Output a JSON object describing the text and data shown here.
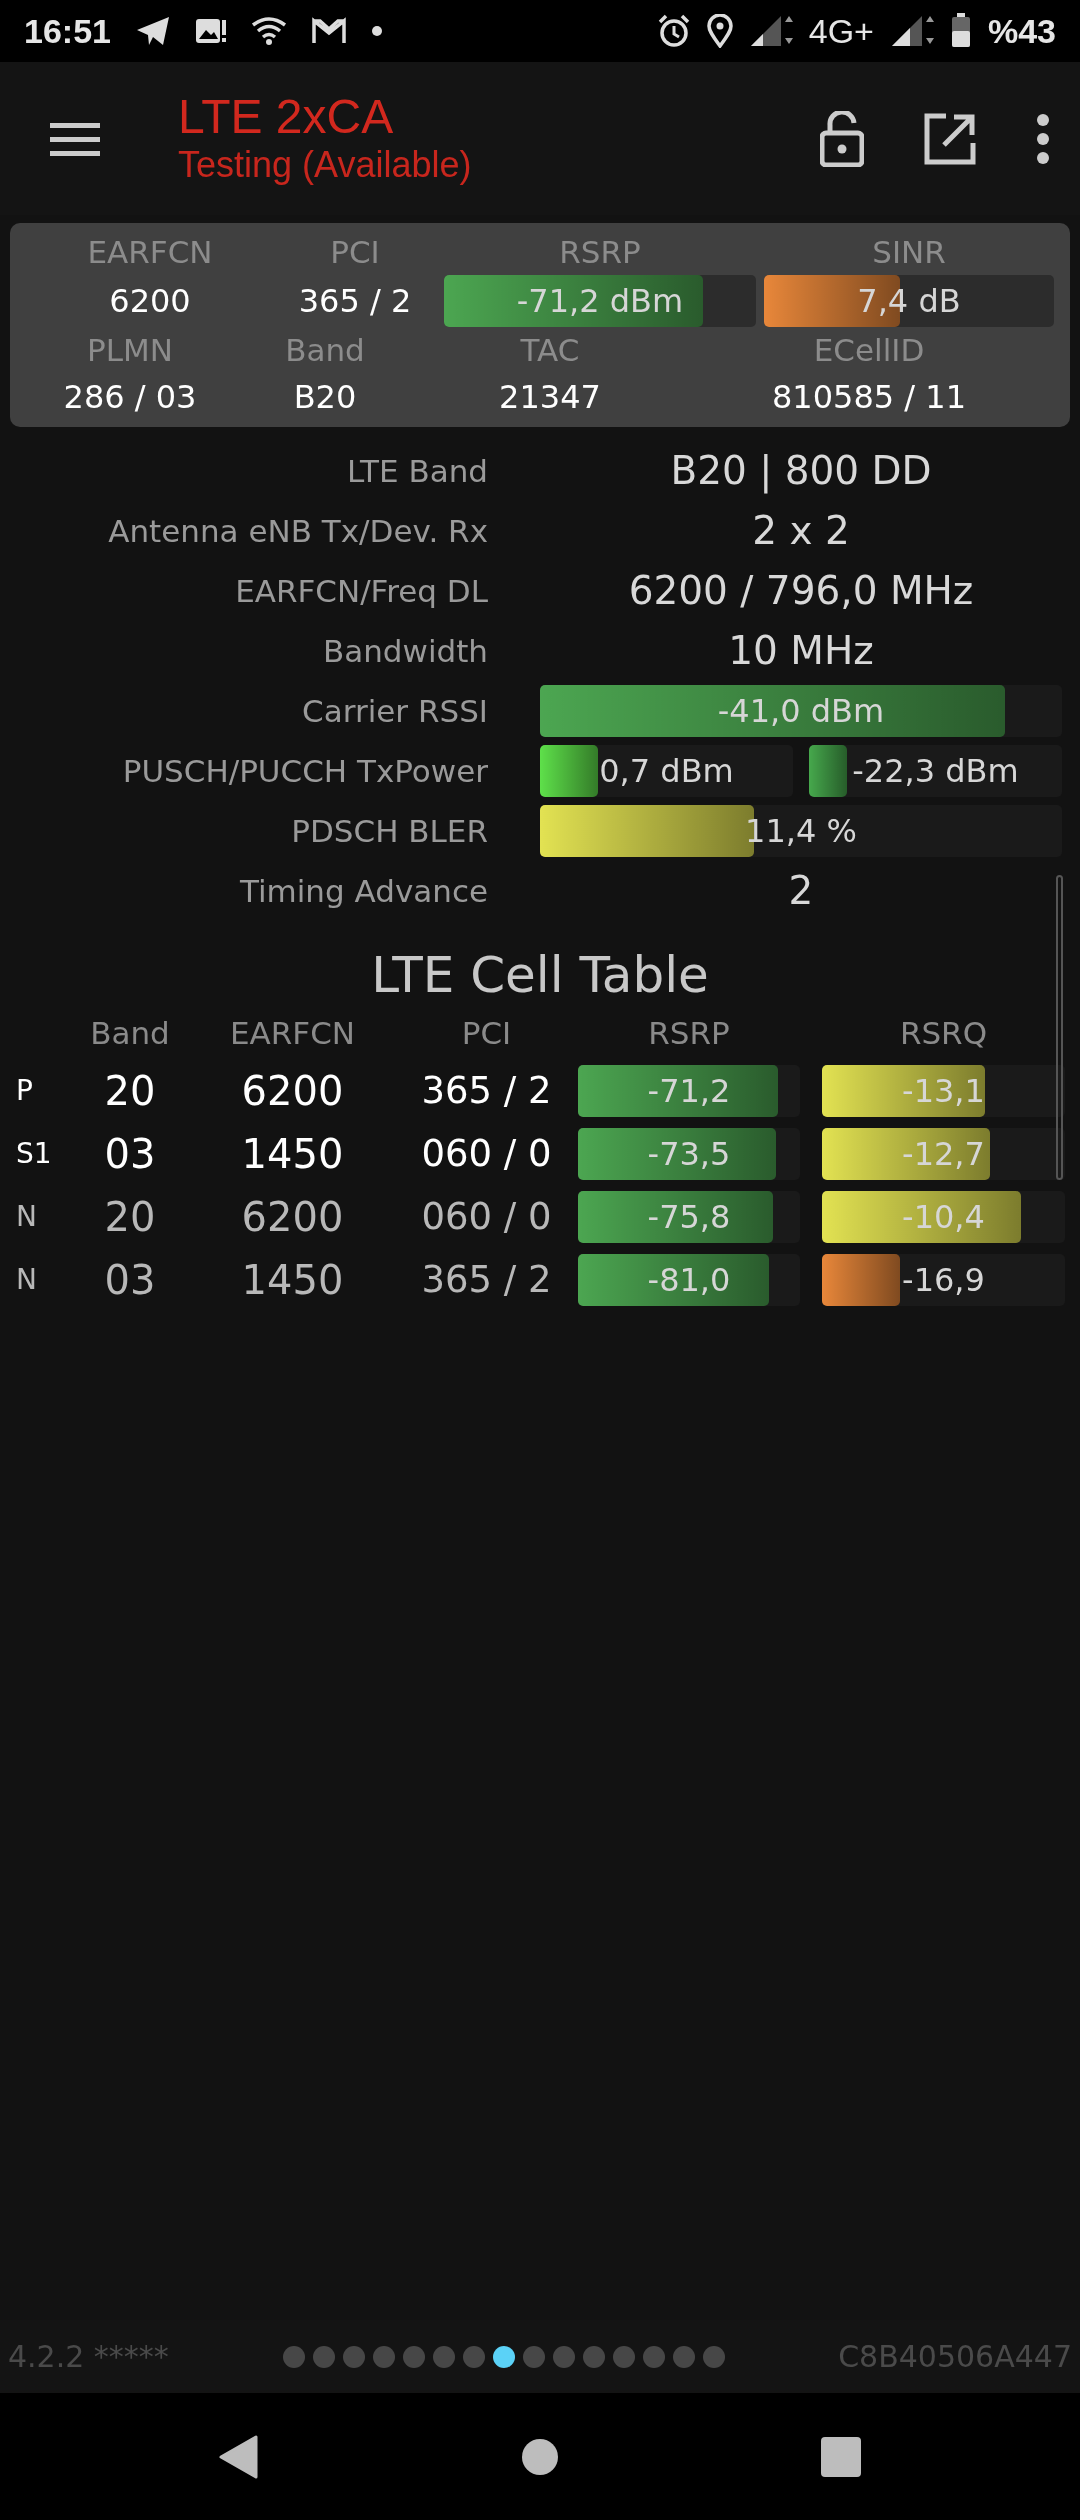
{
  "status_bar": {
    "time": "16:51",
    "network": "4G+",
    "battery": "%43"
  },
  "app_bar": {
    "title": "LTE 2xCA",
    "subtitle": "Testing (Available)"
  },
  "summary": {
    "row_1": [
      {
        "label": "EARFCN",
        "value": "6200"
      },
      {
        "label": "PCI",
        "value": "365 / 2"
      },
      {
        "label": "RSRP",
        "bar": {
          "value": "-71,2 dBm",
          "level": 0.83,
          "color": "#4ca651"
        }
      },
      {
        "label": "SINR",
        "bar": {
          "value": "7,4 dB",
          "level": 0.47,
          "color": "#e8873a"
        }
      }
    ],
    "row_2": [
      {
        "label": "PLMN",
        "value": "286 / 03"
      },
      {
        "label": "Band",
        "value": "B20"
      },
      {
        "label": "TAC",
        "value": "21347"
      },
      {
        "label": "ECellID",
        "value": "810585 / 11"
      }
    ]
  },
  "details": [
    {
      "kind": "text",
      "label": "LTE Band",
      "value": "B20 | 800 DD"
    },
    {
      "kind": "text",
      "label": "Antenna eNB Tx/Dev. Rx",
      "value": "2 x 2"
    },
    {
      "kind": "text",
      "label": "EARFCN/Freq DL",
      "value": "6200 / 796,0 MHz"
    },
    {
      "kind": "text",
      "label": "Bandwidth",
      "value": "10 MHz"
    },
    {
      "kind": "bars",
      "label": "Carrier RSSI",
      "bars": [
        {
          "value": "-41,0 dBm",
          "level": 0.89,
          "color": "#4ca651"
        }
      ]
    },
    {
      "kind": "bars",
      "label": "PUSCH/PUCCH TxPower",
      "bars": [
        {
          "value": "0,7 dBm",
          "level": 0.23,
          "color": "#5ee04a"
        },
        {
          "value": "-22,3 dBm",
          "level": 0.15,
          "color": "#46a84c"
        }
      ]
    },
    {
      "kind": "bars",
      "label": "PDSCH BLER",
      "bars": [
        {
          "value": "11,4 %",
          "level": 0.41,
          "color": "#e2e252"
        }
      ]
    },
    {
      "kind": "text",
      "label": "Timing Advance",
      "value": "2"
    }
  ],
  "cell_table": {
    "title": "LTE Cell Table",
    "columns": [
      "Band",
      "EARFCN",
      "PCI",
      "RSRP",
      "RSRQ"
    ],
    "rows": [
      {
        "type": "P",
        "active": true,
        "band": "20",
        "earfcn": "6200",
        "pci": "365 / 2",
        "rsrp": {
          "value": "-71,2",
          "level": 0.9,
          "color": "#4ca651"
        },
        "rsrq": {
          "value": "-13,1",
          "level": 0.67,
          "color": "#e2e252"
        }
      },
      {
        "type": "S1",
        "active": true,
        "band": "03",
        "earfcn": "1450",
        "pci": "060 / 0",
        "rsrp": {
          "value": "-73,5",
          "level": 0.89,
          "color": "#4ca651"
        },
        "rsrq": {
          "value": "-12,7",
          "level": 0.69,
          "color": "#e2e252"
        }
      },
      {
        "type": "N",
        "active": false,
        "band": "20",
        "earfcn": "6200",
        "pci": "060 / 0",
        "rsrp": {
          "value": "-75,8",
          "level": 0.88,
          "color": "#4ca651"
        },
        "rsrq": {
          "value": "-10,4",
          "level": 0.82,
          "color": "#e2e252"
        }
      },
      {
        "type": "N",
        "active": false,
        "band": "03",
        "earfcn": "1450",
        "pci": "365 / 2",
        "rsrp": {
          "value": "-81,0",
          "level": 0.86,
          "color": "#4ca651"
        },
        "rsrq": {
          "value": "-16,9",
          "level": 0.32,
          "color": "#e8873a"
        }
      }
    ]
  },
  "footer": {
    "version": "4.2.2 *****",
    "device_id": "C8B40506A447",
    "pages": [
      {
        "selected": false
      },
      {
        "selected": false
      },
      {
        "selected": false
      },
      {
        "selected": false
      },
      {
        "selected": false
      },
      {
        "selected": false
      },
      {
        "selected": false
      },
      {
        "selected": true
      },
      {
        "selected": false
      },
      {
        "selected": false
      },
      {
        "selected": false
      },
      {
        "selected": false
      },
      {
        "selected": false
      },
      {
        "selected": false
      },
      {
        "selected": false
      }
    ]
  }
}
